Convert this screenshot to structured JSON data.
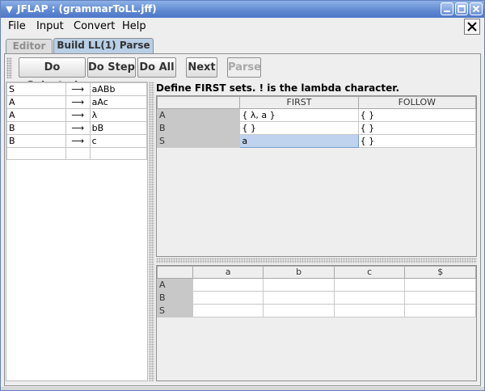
{
  "window": {
    "title": "JFLAP : (grammarToLL.jff)",
    "icon": "chevron-down-icon"
  },
  "menu": [
    "File",
    "Input",
    "Convert",
    "Help"
  ],
  "tabs": [
    {
      "label": "Editor",
      "active": false
    },
    {
      "label": "Build LL(1) Parse",
      "active": true
    }
  ],
  "toolbar": {
    "do_selected": "Do Selected",
    "do_step": "Do Step",
    "do_all": "Do All",
    "next": "Next",
    "parse": "Parse"
  },
  "grammar": {
    "arrow": "⟶",
    "productions": [
      {
        "lhs": "S",
        "rhs": "aABb"
      },
      {
        "lhs": "A",
        "rhs": "aAc"
      },
      {
        "lhs": "A",
        "rhs": "λ"
      },
      {
        "lhs": "B",
        "rhs": "bB"
      },
      {
        "lhs": "B",
        "rhs": "c"
      }
    ]
  },
  "first_follow": {
    "instruction": "Define FIRST sets.  ! is the lambda character.",
    "headers": [
      "",
      "FIRST",
      "FOLLOW"
    ],
    "rows": [
      {
        "var": "A",
        "first": "{ λ, a }",
        "follow": "{ }"
      },
      {
        "var": "B",
        "first": "{ }",
        "follow": "{ }"
      },
      {
        "var": "S",
        "first": "a",
        "follow": "{ }"
      }
    ]
  },
  "parse_table": {
    "headers": [
      "",
      "a",
      "b",
      "c",
      "$"
    ],
    "rows": [
      "A",
      "B",
      "S"
    ]
  },
  "colors": {
    "titlebar": "#5E87D1",
    "selected_cell": "#BFD3EE",
    "row_header": "#C8C8C8"
  }
}
